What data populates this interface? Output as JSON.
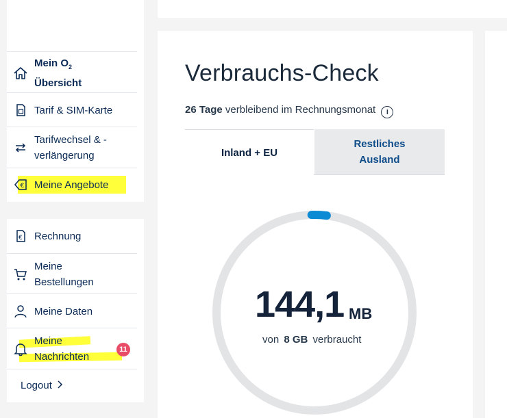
{
  "sidebar": {
    "top_items": [
      {
        "label_main": "Mein O",
        "label_sub": "2",
        "label_line2": "Übersicht",
        "icon": "home-icon"
      },
      {
        "label": "Tarif & SIM-Karte",
        "icon": "sim-card-icon"
      },
      {
        "label_line1": "Tarifwechsel & -",
        "label_line2": "verlängerung",
        "icon": "swap-arrows-icon"
      },
      {
        "label": "Meine Angebote",
        "icon": "euro-tag-icon"
      }
    ],
    "bottom_items": [
      {
        "label": "Rechnung",
        "icon": "invoice-icon"
      },
      {
        "label_line1": "Meine",
        "label_line2": "Bestellungen",
        "icon": "cart-icon"
      },
      {
        "label": "Meine Daten",
        "icon": "user-icon"
      },
      {
        "label_line1": "Meine",
        "label_line2": "Nachrichten",
        "icon": "bell-icon",
        "badge": "11"
      }
    ],
    "logout": {
      "label": "Logout",
      "icon": "chevron-right-icon"
    }
  },
  "usage": {
    "title": "Verbrauchs-Check",
    "days_bold": "26 Tage",
    "days_rest": "verbleibend im Rechnungsmonat",
    "info_icon": "i",
    "tabs": [
      {
        "label": "Inland + EU"
      },
      {
        "label_line1": "Restliches",
        "label_line2": "Ausland"
      }
    ],
    "gauge": {
      "value": "144,1",
      "unit": "MB",
      "sub_prefix": "von",
      "sub_total": "8 GB",
      "sub_suffix": "verbraucht",
      "fraction_used": 0.018
    }
  },
  "colors": {
    "accent": "#0a2a55",
    "gauge_track": "#e3e4e6",
    "gauge_fill": "#0c8ad3",
    "badge": "#e84c67",
    "highlight": "#ffff3a"
  }
}
